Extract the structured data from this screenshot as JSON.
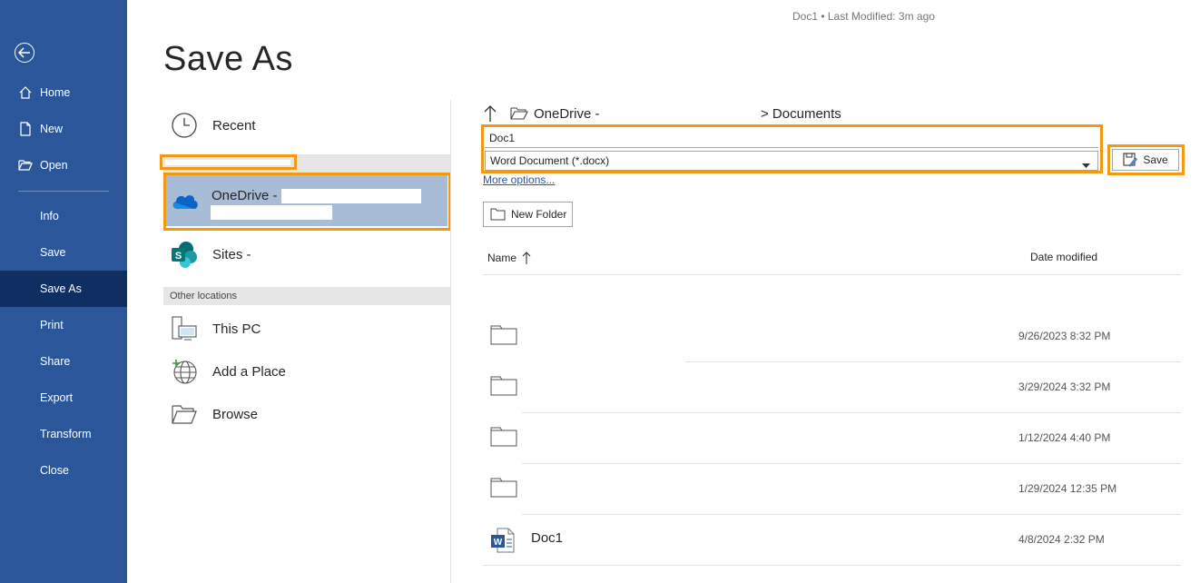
{
  "doc_status": "Doc1  •  Last Modified: 3m ago",
  "page_title": "Save As",
  "nav": {
    "items": [
      {
        "label": "Home"
      },
      {
        "label": "New"
      },
      {
        "label": "Open"
      },
      {
        "label": "Info"
      },
      {
        "label": "Save"
      },
      {
        "label": "Save As"
      },
      {
        "label": "Print"
      },
      {
        "label": "Share"
      },
      {
        "label": "Export"
      },
      {
        "label": "Transform"
      },
      {
        "label": "Close"
      }
    ]
  },
  "locations": {
    "recent": "Recent",
    "onedrive": "OneDrive -",
    "sites": "Sites -",
    "other_locations": "Other locations",
    "this_pc": "This PC",
    "add_place": "Add a Place",
    "browse": "Browse"
  },
  "breadcrumb": {
    "root": "OneDrive -",
    "current": "> Documents"
  },
  "filename": {
    "value": "Doc1"
  },
  "filetype": {
    "value": "Word Document (*.docx)"
  },
  "save_label": "Save",
  "more_options": "More options...",
  "new_folder": "New Folder",
  "columns": {
    "name": "Name",
    "date": "Date modified"
  },
  "files": [
    {
      "type": "folder",
      "name": "",
      "date": "9/26/2023 8:32 PM"
    },
    {
      "type": "folder",
      "name": "",
      "date": "3/29/2024 3:32 PM"
    },
    {
      "type": "folder",
      "name": "",
      "date": "1/12/2024 4:40 PM"
    },
    {
      "type": "folder",
      "name": "",
      "date": "1/29/2024 12:35 PM"
    },
    {
      "type": "word",
      "name": "Doc1",
      "date": "4/8/2024 2:32 PM"
    }
  ],
  "colors": {
    "nav_bg": "#2b579a",
    "nav_active": "#0f2f63",
    "highlight": "#f09a14",
    "selected": "#a9bcd6"
  }
}
